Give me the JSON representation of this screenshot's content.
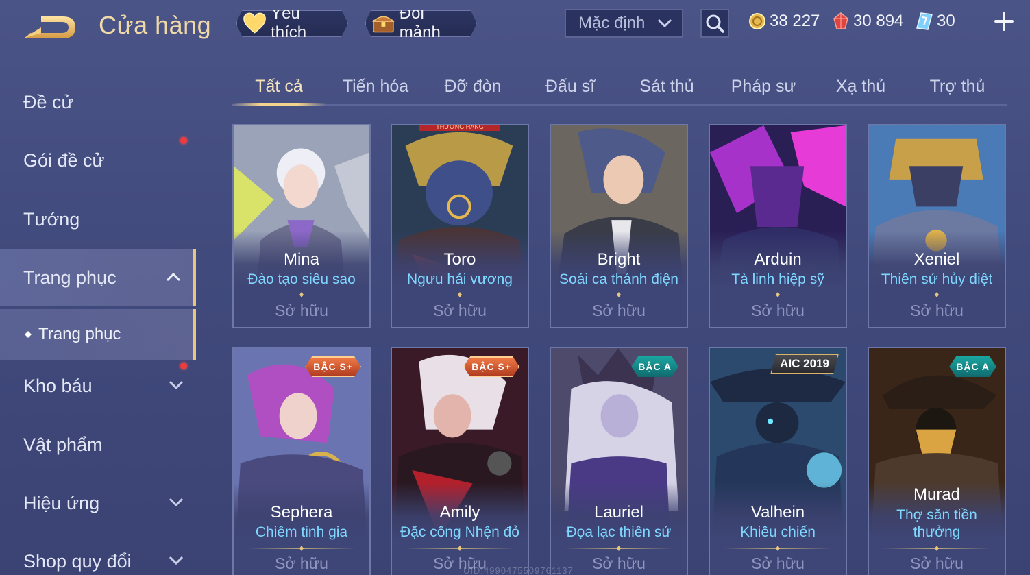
{
  "header": {
    "title": "Cửa hàng",
    "favorites_label": "Yêu thích",
    "shards_label": "Đổi mảnh",
    "sort_value": "Mặc định"
  },
  "currencies": {
    "gold": "38 227",
    "ruby": "30 894",
    "voucher": "30"
  },
  "sidebar": {
    "items": [
      {
        "label": "Đề cử"
      },
      {
        "label": "Gói đề cử"
      },
      {
        "label": "Tướng"
      },
      {
        "label": "Trang phục"
      },
      {
        "label": "Kho báu"
      },
      {
        "label": "Vật phẩm"
      },
      {
        "label": "Hiệu ứng"
      },
      {
        "label": "Shop quy đổi"
      }
    ],
    "sub_item": "Trang phục"
  },
  "tabs": [
    "Tất cả",
    "Tiến hóa",
    "Đỡ đòn",
    "Đấu sĩ",
    "Sát thủ",
    "Pháp sư",
    "Xạ thủ",
    "Trợ thủ"
  ],
  "cards": [
    {
      "hero": "Mina",
      "skin": "Đào tạo siêu sao",
      "status": "Sở hữu"
    },
    {
      "hero": "Toro",
      "skin": "Ngưu hải vương",
      "status": "Sở hữu",
      "ribbon": "THƯỢNG HẠNG"
    },
    {
      "hero": "Bright",
      "skin": "Soái ca thánh điện",
      "status": "Sở hữu"
    },
    {
      "hero": "Arduin",
      "skin": "Tà linh hiệp sỹ",
      "status": "Sở hữu"
    },
    {
      "hero": "Xeniel",
      "skin": "Thiên sứ hủy diệt",
      "status": "Sở hữu"
    },
    {
      "hero": "Sephera",
      "skin": "Chiêm tinh gia",
      "status": "Sở hữu",
      "badge": "BẬC S+"
    },
    {
      "hero": "Amily",
      "skin": "Đặc công Nhện đỏ",
      "status": "Sở hữu",
      "badge": "BẬC S+"
    },
    {
      "hero": "Lauriel",
      "skin": "Đọa lạc thiên sứ",
      "status": "Sở hữu",
      "badge": "BẬC A"
    },
    {
      "hero": "Valhein",
      "skin": "Khiêu chiến",
      "status": "Sở hữu",
      "badge": "AIC 2019"
    },
    {
      "hero": "Murad",
      "skin_line1": "Thợ săn tiền",
      "skin_line2": "thưởng",
      "status": "Sở hữu",
      "badge": "BẬC A"
    }
  ],
  "watermark": "UID:4990475509761137",
  "colors": {
    "background": "#444d80",
    "accent_gold": "#e8c67e",
    "skin_name": "#7fd7ff",
    "notification": "#ef3b3b"
  },
  "icons": [
    "back-arrow-icon",
    "heart-icon",
    "chest-icon",
    "chevron-down-icon",
    "search-icon",
    "gold-coin-icon",
    "ruby-icon",
    "voucher-icon",
    "plus-icon",
    "chevron-up-icon",
    "diamond-bullet-icon"
  ]
}
